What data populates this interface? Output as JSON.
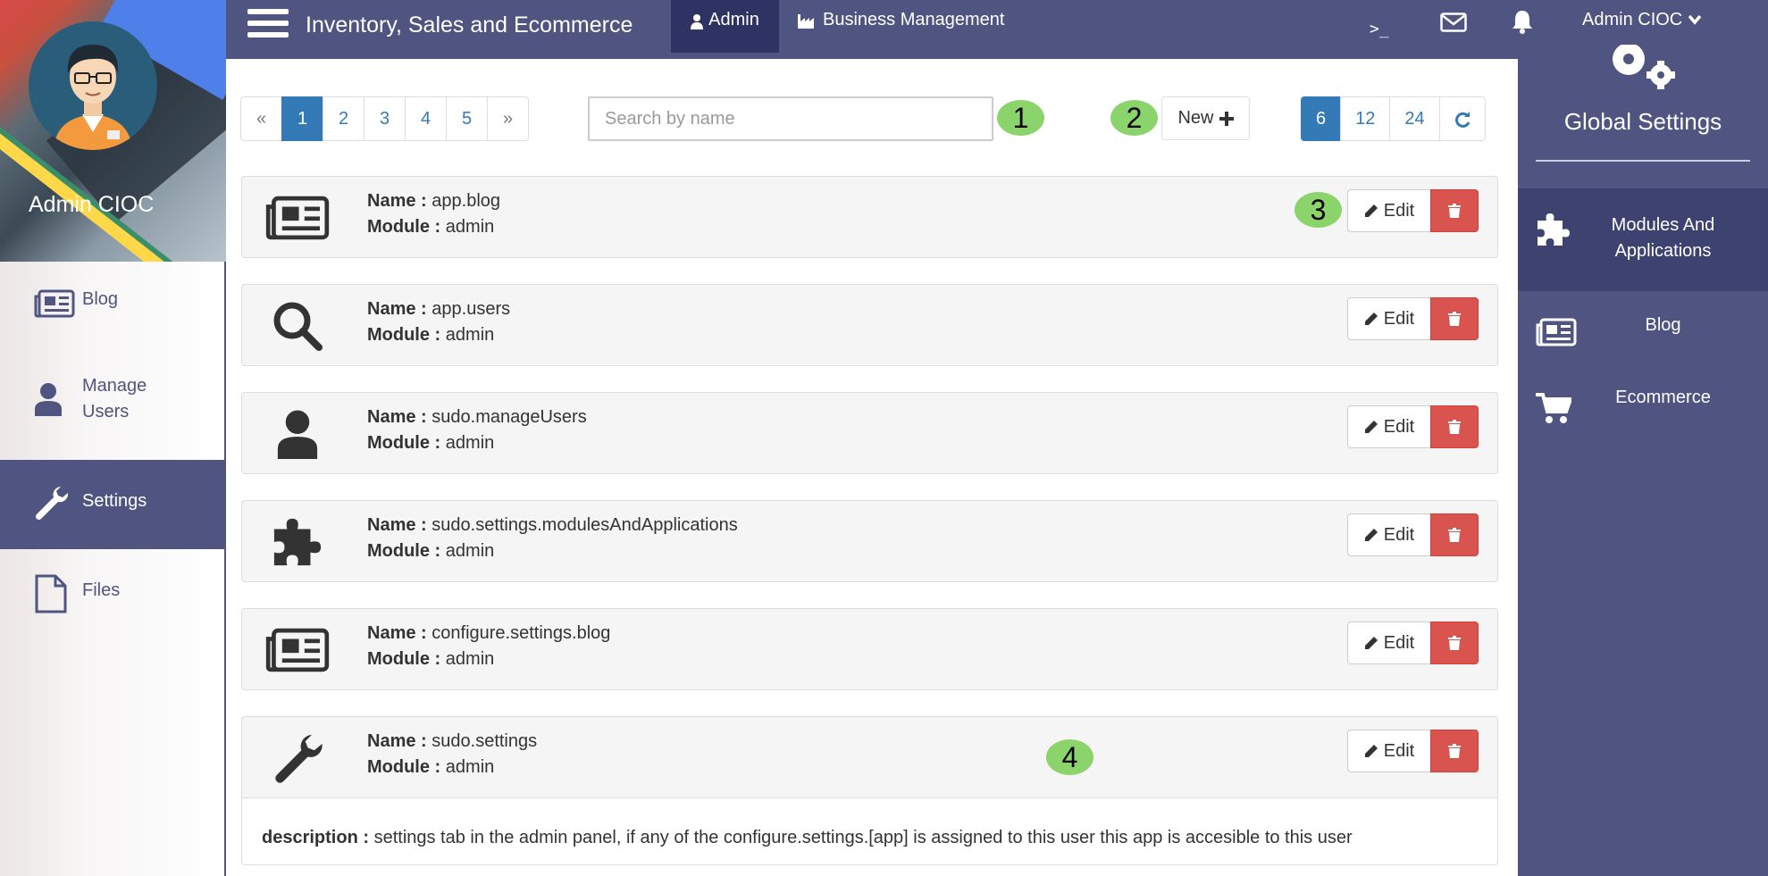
{
  "topbar": {
    "app_title": "Inventory, Sales and Ecommerce",
    "nav_admin": "Admin",
    "nav_business": "Business Management",
    "terminal_glyph": ">_",
    "user_menu": "Admin CIOC"
  },
  "profile": {
    "name": "Admin CIOC"
  },
  "sidebar": {
    "items": [
      {
        "label": "Blog",
        "icon": "newspaper-icon"
      },
      {
        "label": "Manage Users",
        "icon": "user-icon"
      },
      {
        "label": "Settings",
        "icon": "wrench-icon",
        "active": true
      },
      {
        "label": "Files",
        "icon": "file-icon"
      }
    ]
  },
  "right_panel": {
    "title": "Global Settings",
    "items": [
      {
        "label": "Modules And Applications",
        "icon": "puzzle-icon",
        "active": true
      },
      {
        "label": "Blog",
        "icon": "newspaper-icon"
      },
      {
        "label": "Ecommerce",
        "icon": "cart-icon"
      }
    ]
  },
  "toolbar": {
    "pager": [
      "«",
      "1",
      "2",
      "3",
      "4",
      "5",
      "»"
    ],
    "current_page": "1",
    "search_placeholder": "Search by name",
    "new_label": "New",
    "page_sizes": [
      "6",
      "12",
      "24"
    ],
    "selected_page_size": "6"
  },
  "annotations": [
    "1",
    "2",
    "3",
    "4"
  ],
  "labels": {
    "name": "Name :",
    "module": "Module :",
    "description": "description :",
    "edit": "Edit"
  },
  "apps": [
    {
      "name": "app.blog",
      "module": "admin",
      "icon": "newspaper-icon"
    },
    {
      "name": "app.users",
      "module": "admin",
      "icon": "search-icon"
    },
    {
      "name": "sudo.manageUsers",
      "module": "admin",
      "icon": "user-icon"
    },
    {
      "name": "sudo.settings.modulesAndApplications",
      "module": "admin",
      "icon": "puzzle-icon"
    },
    {
      "name": "configure.settings.blog",
      "module": "admin",
      "icon": "newspaper-icon"
    },
    {
      "name": "sudo.settings",
      "module": "admin",
      "icon": "wrench-icon",
      "description": "settings tab in the admin panel, if any of the configure.settings.[app] is assigned to this user this app is accesible to this user"
    }
  ],
  "colors": {
    "nav": "#4f5480",
    "nav_dark": "#2f3364",
    "primary": "#337ab7",
    "danger": "#d9534f",
    "badge": "#8bd36b"
  }
}
